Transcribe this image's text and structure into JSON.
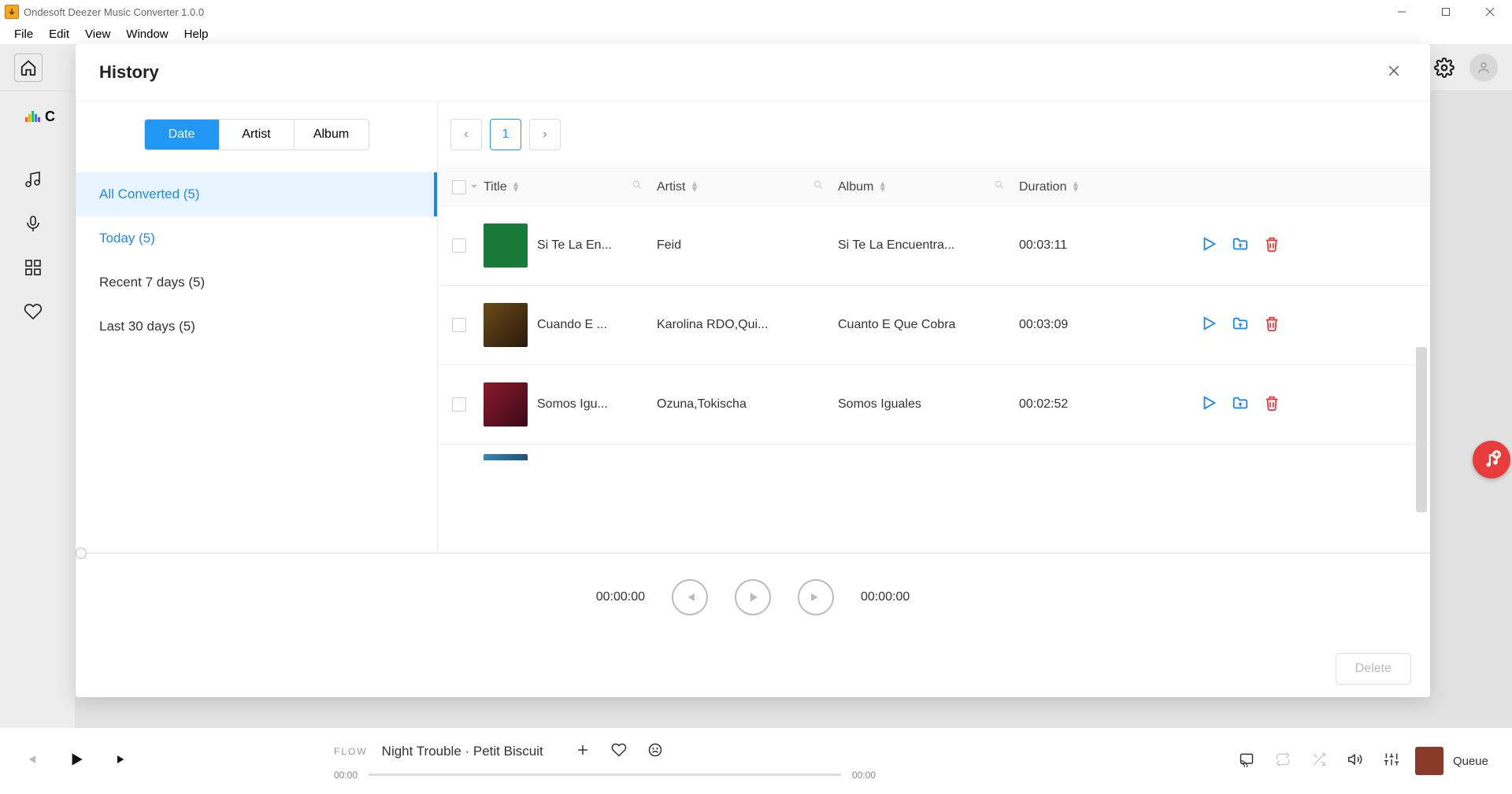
{
  "window": {
    "title": "Ondesoft Deezer Music Converter 1.0.0"
  },
  "menu": {
    "file": "File",
    "edit": "Edit",
    "view": "View",
    "window": "Window",
    "help": "Help"
  },
  "modal": {
    "title": "History",
    "tabs": {
      "date": "Date",
      "artist": "Artist",
      "album": "Album"
    },
    "sidebar": {
      "all": "All Converted (5)",
      "today": "Today (5)",
      "recent7": "Recent 7 days (5)",
      "last30": "Last 30 days (5)"
    },
    "pagination": {
      "page": "1"
    },
    "columns": {
      "title": "Title",
      "artist": "Artist",
      "album": "Album",
      "duration": "Duration"
    },
    "rows": [
      {
        "title": "Si Te La En...",
        "artist": "Feid",
        "album": "Si Te La Encuentra...",
        "duration": "00:03:11"
      },
      {
        "title": "Cuando E ...",
        "artist": "Karolina RDO,Qui...",
        "album": "Cuanto E Que Cobra",
        "duration": "00:03:09"
      },
      {
        "title": "Somos Igu...",
        "artist": "Ozuna,Tokischa",
        "album": "Somos Iguales",
        "duration": "00:02:52"
      }
    ],
    "player": {
      "elapsed": "00:00:00",
      "total": "00:00:00"
    },
    "delete_label": "Delete"
  },
  "playerbar": {
    "flow_label": "FLOW",
    "now_playing": "Night Trouble · Petit Biscuit",
    "elapsed": "00:00",
    "total": "00:00",
    "queue_label": "Queue"
  }
}
